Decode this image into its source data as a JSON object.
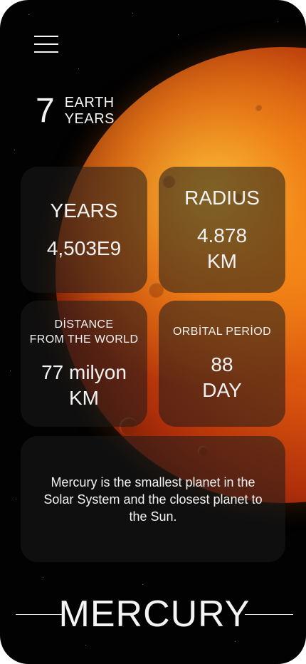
{
  "header": {
    "menu_icon": "hamburger-menu-icon",
    "age_value": "7",
    "age_unit_line1": "EARTH",
    "age_unit_line2": "YEARS"
  },
  "cards": {
    "years": {
      "title": "YEARS",
      "value": "4,503E9"
    },
    "radius": {
      "title": "RADIUS",
      "value_line1": "4.878",
      "value_line2": "KM"
    },
    "distance": {
      "title_line1": "DİSTANCE",
      "title_line2": "FROM THE WORLD",
      "value_line1": "77 milyon",
      "value_line2": "KM"
    },
    "orbital": {
      "title": "ORBİTAL PERİOD",
      "value_line1": "88",
      "value_line2": "DAY"
    }
  },
  "description": "Mercury is the smallest planet in the Solar System and the closest planet to the Sun.",
  "footer": {
    "planet_name": "MERCURY"
  },
  "colors": {
    "background": "#020202",
    "planet": "#e0600e",
    "text": "#f2f2f2"
  }
}
